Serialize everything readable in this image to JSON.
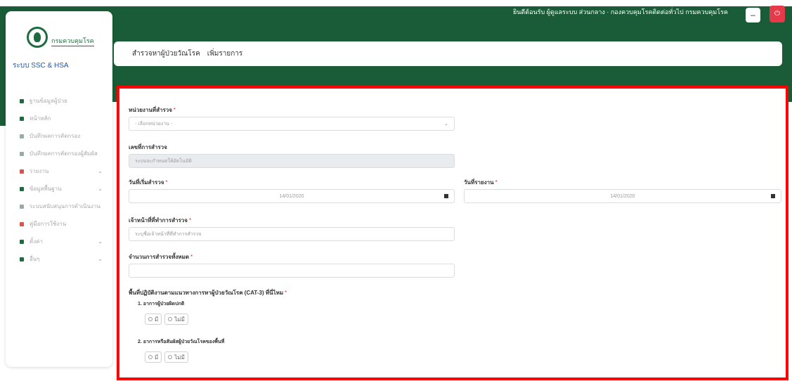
{
  "sidebar": {
    "logo_name": "กรมควบคุมโรค",
    "system_name": "ระบบ SSC & HSA",
    "items": [
      {
        "label": "ฐานข้อมูลผู้ป่วย",
        "icon": "square-icon",
        "color": "green",
        "chevron": ""
      },
      {
        "label": "หน้าหลัก",
        "icon": "home-icon",
        "color": "green",
        "chevron": ""
      },
      {
        "label": "บันทึกผลการคัดกรอง",
        "icon": "list-icon",
        "color": "grey",
        "chevron": ""
      },
      {
        "label": "บันทึกผลการคัดกรองผู้สัมผัส",
        "icon": "list-icon",
        "color": "grey",
        "chevron": ""
      },
      {
        "label": "รายงาน",
        "icon": "chart-icon",
        "color": "red",
        "chevron": "⌄"
      },
      {
        "label": "ข้อมูลพื้นฐาน",
        "icon": "database-icon",
        "color": "green",
        "chevron": "⌄"
      },
      {
        "label": "ระบบสนับสนุนการดำเนินงาน",
        "icon": "clipboard-icon",
        "color": "grey",
        "chevron": ""
      },
      {
        "label": "คู่มือการใช้งาน",
        "icon": "book-icon",
        "color": "red",
        "chevron": ""
      },
      {
        "label": "ตั้งค่า",
        "icon": "gear-icon",
        "color": "green",
        "chevron": "⌄"
      },
      {
        "label": "อื่นๆ",
        "icon": "info-icon",
        "color": "green",
        "chevron": "⌄"
      }
    ]
  },
  "header": {
    "user_text": "ยินดีต้อนรับ ผู้ดูแลระบบ ส่วนกลาง · กองควบคุมโรคติดต่อทั่วไป กรมควบคุมโรค",
    "min_button": "–",
    "power_button": "⏻"
  },
  "breadcrumb": {
    "title": "สำรวจหาผู้ป่วยวัณโรค",
    "action": "เพิ่มรายการ"
  },
  "form": {
    "agency_label": "หน่วยงานที่สำรวจ",
    "agency_value": "- เลือกหน่วยงาน -",
    "survey_id_label": "เลขที่การสำรวจ",
    "survey_id_value": "ระบบจะกำหนดให้อัตโนมัติ",
    "start_date_label": "วันที่เริ่มสำรวจ",
    "start_date_value": "14/01/2020",
    "end_date_label": "วันที่รายงาน",
    "end_date_value": "14/01/2020",
    "staff_label": "เจ้าหน้าที่ที่ทำการสำรวจ",
    "staff_placeholder": "ระบุชื่อเจ้าหน้าที่ที่ทำการสำรวจ",
    "total_label": "จำนวนการสำรวจทั้งหมด",
    "total_value": "",
    "question_label": "พื้นที่ปฏิบัติงานตามแนวทางการหาผู้ป่วยวัณโรค (CAT-3) ที่นี่ไหม",
    "q1_label": "1. อาการผู้ป่วยผิดปกติ",
    "q1_yes": "มี",
    "q1_no": "ไม่มี",
    "q2_label": "2. อาการหรือสัมผัสผู้ป่วยวัณโรคของพื้นที่",
    "q2_yes": "มี",
    "q2_no": "ไม่มี"
  },
  "colors": {
    "brand_green": "#1a5c38",
    "highlight_border": "#ff0000",
    "danger": "#e6394a"
  }
}
